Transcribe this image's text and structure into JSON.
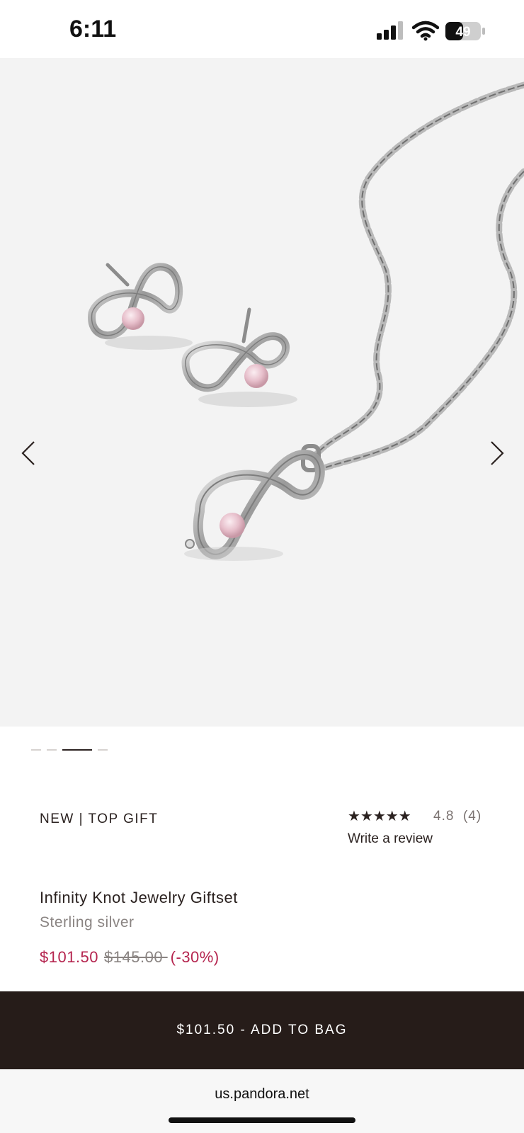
{
  "status_bar": {
    "time": "6:11",
    "battery": "49"
  },
  "product": {
    "badge": "NEW | TOP GIFT",
    "stars": "★★★★★",
    "rating": "4.8",
    "review_count": "(4)",
    "write_review": "Write a review",
    "name": "Infinity Knot Jewelry Giftset",
    "material": "Sterling silver",
    "price_sale": "$101.50",
    "price_original": "$145.00 ",
    "discount": "(-30%)"
  },
  "gallery": {
    "image_count": 4,
    "active_index": 2
  },
  "cta": {
    "label": "$101.50 - ADD TO BAG"
  },
  "browser": {
    "url": "us.pandora.net"
  },
  "colors": {
    "sale": "#b5254f",
    "cta_bg": "#261c19",
    "gallery_bg": "#f3f3f3"
  }
}
